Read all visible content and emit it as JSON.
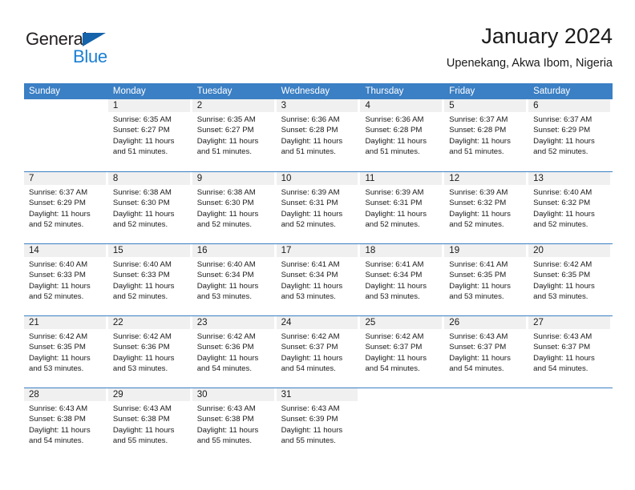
{
  "brand": {
    "name_primary": "General",
    "name_secondary": "Blue",
    "triangle_color": "#1463ab",
    "secondary_color": "#1a7fd4"
  },
  "header": {
    "title": "January 2024",
    "subtitle": "Upenekang, Akwa Ibom, Nigeria"
  },
  "theme": {
    "header_blue": "#3b7fc4",
    "day_band_gray": "#f0f0f0",
    "text_color": "#1a1a1a"
  },
  "weekdays": [
    "Sunday",
    "Monday",
    "Tuesday",
    "Wednesday",
    "Thursday",
    "Friday",
    "Saturday"
  ],
  "weeks": [
    [
      {
        "day": ""
      },
      {
        "day": "1",
        "sunrise": "Sunrise: 6:35 AM",
        "sunset": "Sunset: 6:27 PM",
        "daylight1": "Daylight: 11 hours",
        "daylight2": "and 51 minutes."
      },
      {
        "day": "2",
        "sunrise": "Sunrise: 6:35 AM",
        "sunset": "Sunset: 6:27 PM",
        "daylight1": "Daylight: 11 hours",
        "daylight2": "and 51 minutes."
      },
      {
        "day": "3",
        "sunrise": "Sunrise: 6:36 AM",
        "sunset": "Sunset: 6:28 PM",
        "daylight1": "Daylight: 11 hours",
        "daylight2": "and 51 minutes."
      },
      {
        "day": "4",
        "sunrise": "Sunrise: 6:36 AM",
        "sunset": "Sunset: 6:28 PM",
        "daylight1": "Daylight: 11 hours",
        "daylight2": "and 51 minutes."
      },
      {
        "day": "5",
        "sunrise": "Sunrise: 6:37 AM",
        "sunset": "Sunset: 6:28 PM",
        "daylight1": "Daylight: 11 hours",
        "daylight2": "and 51 minutes."
      },
      {
        "day": "6",
        "sunrise": "Sunrise: 6:37 AM",
        "sunset": "Sunset: 6:29 PM",
        "daylight1": "Daylight: 11 hours",
        "daylight2": "and 52 minutes."
      }
    ],
    [
      {
        "day": "7",
        "sunrise": "Sunrise: 6:37 AM",
        "sunset": "Sunset: 6:29 PM",
        "daylight1": "Daylight: 11 hours",
        "daylight2": "and 52 minutes."
      },
      {
        "day": "8",
        "sunrise": "Sunrise: 6:38 AM",
        "sunset": "Sunset: 6:30 PM",
        "daylight1": "Daylight: 11 hours",
        "daylight2": "and 52 minutes."
      },
      {
        "day": "9",
        "sunrise": "Sunrise: 6:38 AM",
        "sunset": "Sunset: 6:30 PM",
        "daylight1": "Daylight: 11 hours",
        "daylight2": "and 52 minutes."
      },
      {
        "day": "10",
        "sunrise": "Sunrise: 6:39 AM",
        "sunset": "Sunset: 6:31 PM",
        "daylight1": "Daylight: 11 hours",
        "daylight2": "and 52 minutes."
      },
      {
        "day": "11",
        "sunrise": "Sunrise: 6:39 AM",
        "sunset": "Sunset: 6:31 PM",
        "daylight1": "Daylight: 11 hours",
        "daylight2": "and 52 minutes."
      },
      {
        "day": "12",
        "sunrise": "Sunrise: 6:39 AM",
        "sunset": "Sunset: 6:32 PM",
        "daylight1": "Daylight: 11 hours",
        "daylight2": "and 52 minutes."
      },
      {
        "day": "13",
        "sunrise": "Sunrise: 6:40 AM",
        "sunset": "Sunset: 6:32 PM",
        "daylight1": "Daylight: 11 hours",
        "daylight2": "and 52 minutes."
      }
    ],
    [
      {
        "day": "14",
        "sunrise": "Sunrise: 6:40 AM",
        "sunset": "Sunset: 6:33 PM",
        "daylight1": "Daylight: 11 hours",
        "daylight2": "and 52 minutes."
      },
      {
        "day": "15",
        "sunrise": "Sunrise: 6:40 AM",
        "sunset": "Sunset: 6:33 PM",
        "daylight1": "Daylight: 11 hours",
        "daylight2": "and 52 minutes."
      },
      {
        "day": "16",
        "sunrise": "Sunrise: 6:40 AM",
        "sunset": "Sunset: 6:34 PM",
        "daylight1": "Daylight: 11 hours",
        "daylight2": "and 53 minutes."
      },
      {
        "day": "17",
        "sunrise": "Sunrise: 6:41 AM",
        "sunset": "Sunset: 6:34 PM",
        "daylight1": "Daylight: 11 hours",
        "daylight2": "and 53 minutes."
      },
      {
        "day": "18",
        "sunrise": "Sunrise: 6:41 AM",
        "sunset": "Sunset: 6:34 PM",
        "daylight1": "Daylight: 11 hours",
        "daylight2": "and 53 minutes."
      },
      {
        "day": "19",
        "sunrise": "Sunrise: 6:41 AM",
        "sunset": "Sunset: 6:35 PM",
        "daylight1": "Daylight: 11 hours",
        "daylight2": "and 53 minutes."
      },
      {
        "day": "20",
        "sunrise": "Sunrise: 6:42 AM",
        "sunset": "Sunset: 6:35 PM",
        "daylight1": "Daylight: 11 hours",
        "daylight2": "and 53 minutes."
      }
    ],
    [
      {
        "day": "21",
        "sunrise": "Sunrise: 6:42 AM",
        "sunset": "Sunset: 6:35 PM",
        "daylight1": "Daylight: 11 hours",
        "daylight2": "and 53 minutes."
      },
      {
        "day": "22",
        "sunrise": "Sunrise: 6:42 AM",
        "sunset": "Sunset: 6:36 PM",
        "daylight1": "Daylight: 11 hours",
        "daylight2": "and 53 minutes."
      },
      {
        "day": "23",
        "sunrise": "Sunrise: 6:42 AM",
        "sunset": "Sunset: 6:36 PM",
        "daylight1": "Daylight: 11 hours",
        "daylight2": "and 54 minutes."
      },
      {
        "day": "24",
        "sunrise": "Sunrise: 6:42 AM",
        "sunset": "Sunset: 6:37 PM",
        "daylight1": "Daylight: 11 hours",
        "daylight2": "and 54 minutes."
      },
      {
        "day": "25",
        "sunrise": "Sunrise: 6:42 AM",
        "sunset": "Sunset: 6:37 PM",
        "daylight1": "Daylight: 11 hours",
        "daylight2": "and 54 minutes."
      },
      {
        "day": "26",
        "sunrise": "Sunrise: 6:43 AM",
        "sunset": "Sunset: 6:37 PM",
        "daylight1": "Daylight: 11 hours",
        "daylight2": "and 54 minutes."
      },
      {
        "day": "27",
        "sunrise": "Sunrise: 6:43 AM",
        "sunset": "Sunset: 6:37 PM",
        "daylight1": "Daylight: 11 hours",
        "daylight2": "and 54 minutes."
      }
    ],
    [
      {
        "day": "28",
        "sunrise": "Sunrise: 6:43 AM",
        "sunset": "Sunset: 6:38 PM",
        "daylight1": "Daylight: 11 hours",
        "daylight2": "and 54 minutes."
      },
      {
        "day": "29",
        "sunrise": "Sunrise: 6:43 AM",
        "sunset": "Sunset: 6:38 PM",
        "daylight1": "Daylight: 11 hours",
        "daylight2": "and 55 minutes."
      },
      {
        "day": "30",
        "sunrise": "Sunrise: 6:43 AM",
        "sunset": "Sunset: 6:38 PM",
        "daylight1": "Daylight: 11 hours",
        "daylight2": "and 55 minutes."
      },
      {
        "day": "31",
        "sunrise": "Sunrise: 6:43 AM",
        "sunset": "Sunset: 6:39 PM",
        "daylight1": "Daylight: 11 hours",
        "daylight2": "and 55 minutes."
      },
      {
        "day": ""
      },
      {
        "day": ""
      },
      {
        "day": ""
      }
    ]
  ]
}
